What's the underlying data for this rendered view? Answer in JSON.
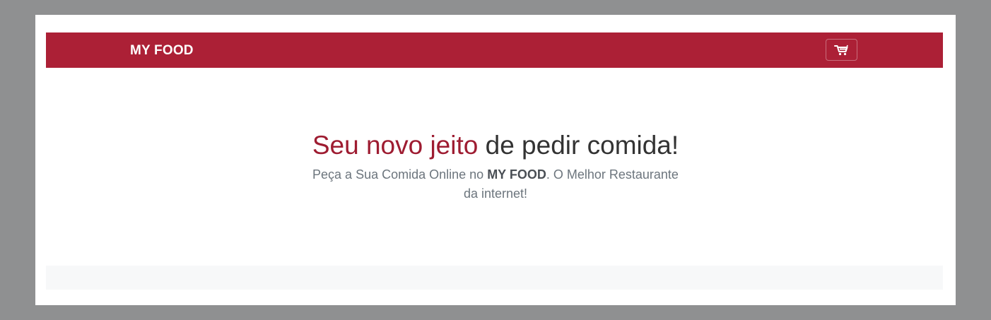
{
  "colors": {
    "backdrop": "#8f9091",
    "navbar": "#ac2036",
    "accent": "#9e1c31",
    "muted_text": "#6c757d",
    "footer": "#f7f8f9"
  },
  "navbar": {
    "brand": "MY FOOD",
    "cart_icon": "shopping-cart-icon"
  },
  "hero": {
    "title_accent": "Seu novo jeito",
    "title_rest": " de pedir comida!",
    "subtitle_before": "Peça a Sua Comida Online no ",
    "subtitle_brand": "MY FOOD",
    "subtitle_after": ". O Melhor Restaurante da internet!"
  }
}
